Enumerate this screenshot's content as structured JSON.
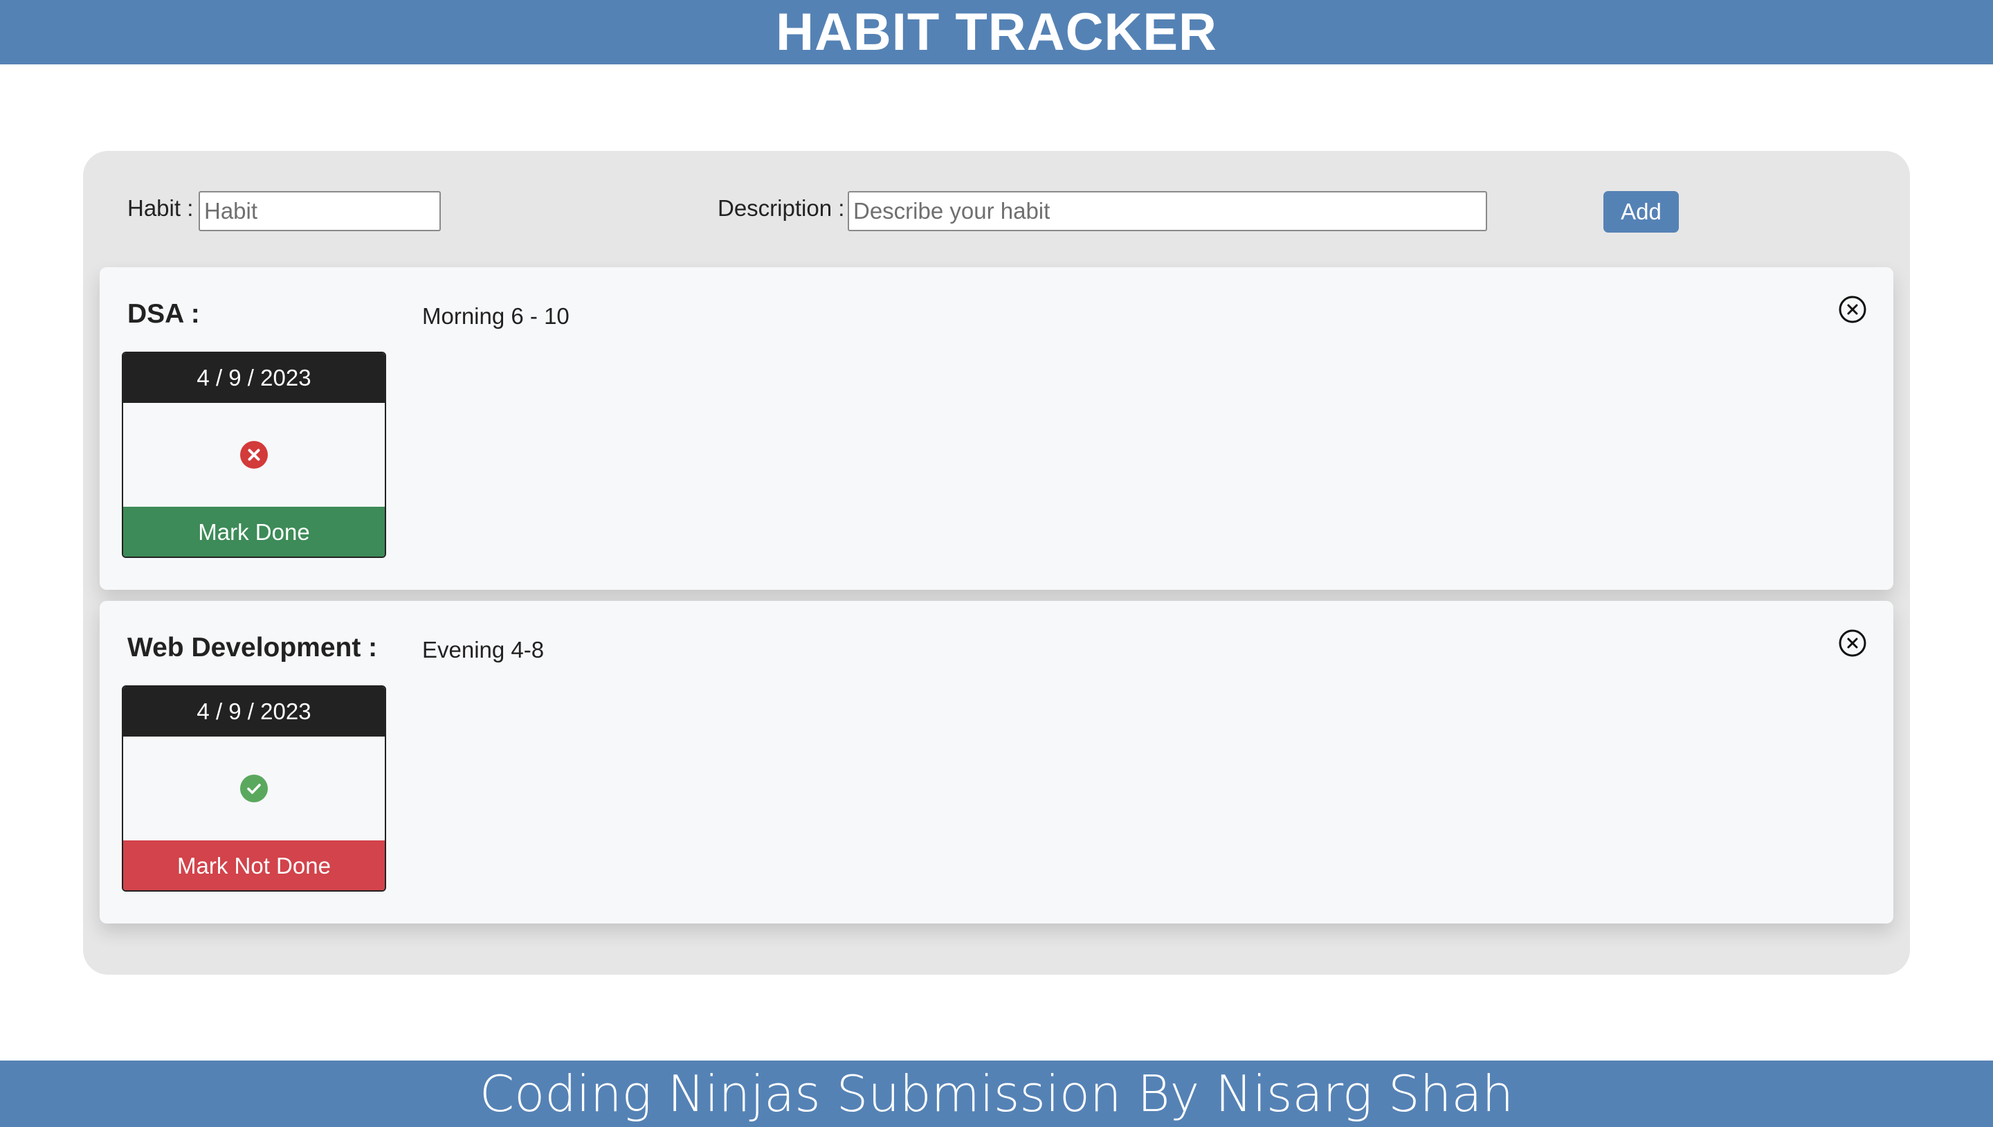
{
  "header": {
    "title": "HABIT TRACKER"
  },
  "form": {
    "habit_label": "Habit :",
    "habit_placeholder": "Habit",
    "description_label": "Description :",
    "description_placeholder": "Describe your habit",
    "add_label": "Add"
  },
  "habits": [
    {
      "name": "DSA :",
      "description": "Morning 6 - 10",
      "date": "4 / 9 / 2023",
      "status": "not-done",
      "status_icon": "x-circle-icon",
      "status_color": "#d33a3a",
      "button_label": "Mark Done",
      "button_color": "#3d8b58"
    },
    {
      "name": "Web Development :",
      "description": "Evening 4-8",
      "date": "4 / 9 / 2023",
      "status": "done",
      "status_icon": "check-circle-icon",
      "status_color": "#5aa85e",
      "button_label": "Mark Not Done",
      "button_color": "#d2434b"
    }
  ],
  "footer": {
    "text": "Coding Ninjas Submission By Nisarg Shah"
  },
  "colors": {
    "accent": "#5582b5",
    "panel": "#e6e6e6",
    "card": "#f7f8fa"
  }
}
